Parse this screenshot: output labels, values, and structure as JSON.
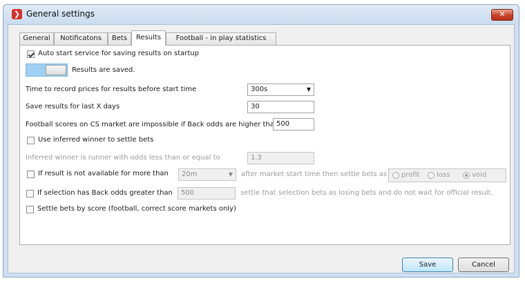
{
  "window": {
    "title": "General settings",
    "close_label": "✕"
  },
  "tabs": [
    "General",
    "Notificatons",
    "Bets",
    "Results",
    "Football - in play statistics"
  ],
  "active_tab": "Results",
  "settings": {
    "auto_start_label": "Auto start service for saving results on startup",
    "auto_start_checked": true,
    "toggle_status": "Results are saved.",
    "time_to_record_label": "Time to record prices for results before start time",
    "time_to_record_value": "300s",
    "save_results_label": "Save results for last X days",
    "save_results_value": "30",
    "cs_market_label": "Football scores on CS market are impossible if Back odds are higher than",
    "cs_market_value": "500",
    "inferred_winner_label": "Use inferred winner to settle bets",
    "inferred_odds_label": "Inferred winner is runner with odds less than or equal to",
    "inferred_odds_value": "1.3",
    "result_unavailable_label": "If result is not available for more than",
    "result_unavailable_value": "20m",
    "after_start_label": "after market start time then settle bets as",
    "radio_options": [
      "profit",
      "loss",
      "void"
    ],
    "radio_selected": "void",
    "back_odds_label": "If selection has Back odds greater than",
    "back_odds_value": "500",
    "back_odds_suffix": "settle that selection bets as losing bets and do not wait for official result.",
    "settle_by_score_label": "Settle bets by score (football, correct score markets only)"
  },
  "buttons": {
    "save": "Save",
    "cancel": "Cancel"
  }
}
